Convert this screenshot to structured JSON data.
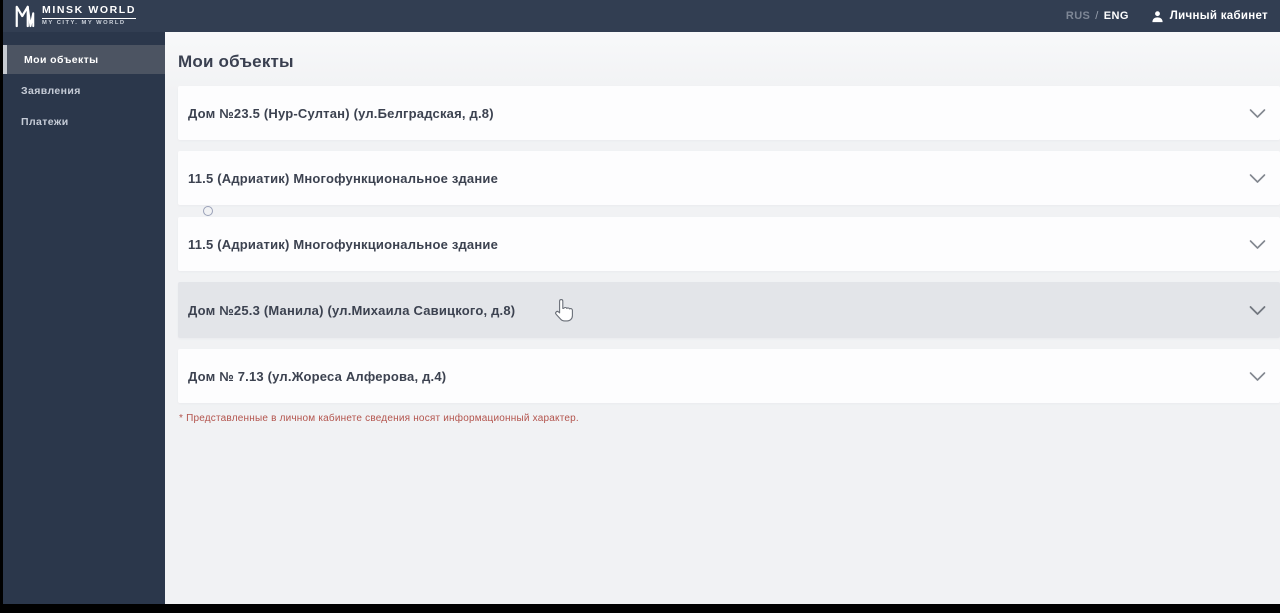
{
  "header": {
    "logo": {
      "monogram_icon": "mw-monogram",
      "title": "MINSK WORLD",
      "subtitle": "MY CITY. MY WORLD"
    },
    "language": {
      "rus": "RUS",
      "separator": "/",
      "eng": "ENG"
    },
    "account_label": "Личный кабинет",
    "colors": {
      "bar": "#323e52",
      "active_lang": "#ffffff",
      "inactive_lang": "#7e8796"
    }
  },
  "sidebar": {
    "items": [
      {
        "label": "Мои объекты",
        "active": true
      },
      {
        "label": "Заявления",
        "active": false
      },
      {
        "label": "Платежи",
        "active": false
      }
    ],
    "colors": {
      "background": "#2b374b",
      "active_background": "#4c5462",
      "text": "#c6ccd7"
    }
  },
  "main": {
    "title": "Мои объекты",
    "objects": [
      {
        "label": "Дом №23.5 (Нур-Султан) (ул.Белградская, д.8)",
        "state": "collapsed"
      },
      {
        "label": "11.5 (Адриатик) Многофункциональное здание",
        "state": "collapsed"
      },
      {
        "label": "11.5 (Адриатик) Многофункциональное здание",
        "state": "collapsed"
      },
      {
        "label": "Дом №25.3 (Манила) (ул.Михаила Савицкого, д.8)",
        "state": "collapsed-hovered"
      },
      {
        "label": "Дом № 7.13 (ул.Жореса Алферова, д.4)",
        "state": "collapsed"
      }
    ],
    "footnote": "* Представленные в личном кабинете сведения носят информационный характер.",
    "colors": {
      "background": "#f1f2f4",
      "row": "#fdfdfe",
      "row_hover": "#e3e5e9",
      "text": "#3c4250",
      "footnote": "#b3544d"
    }
  }
}
